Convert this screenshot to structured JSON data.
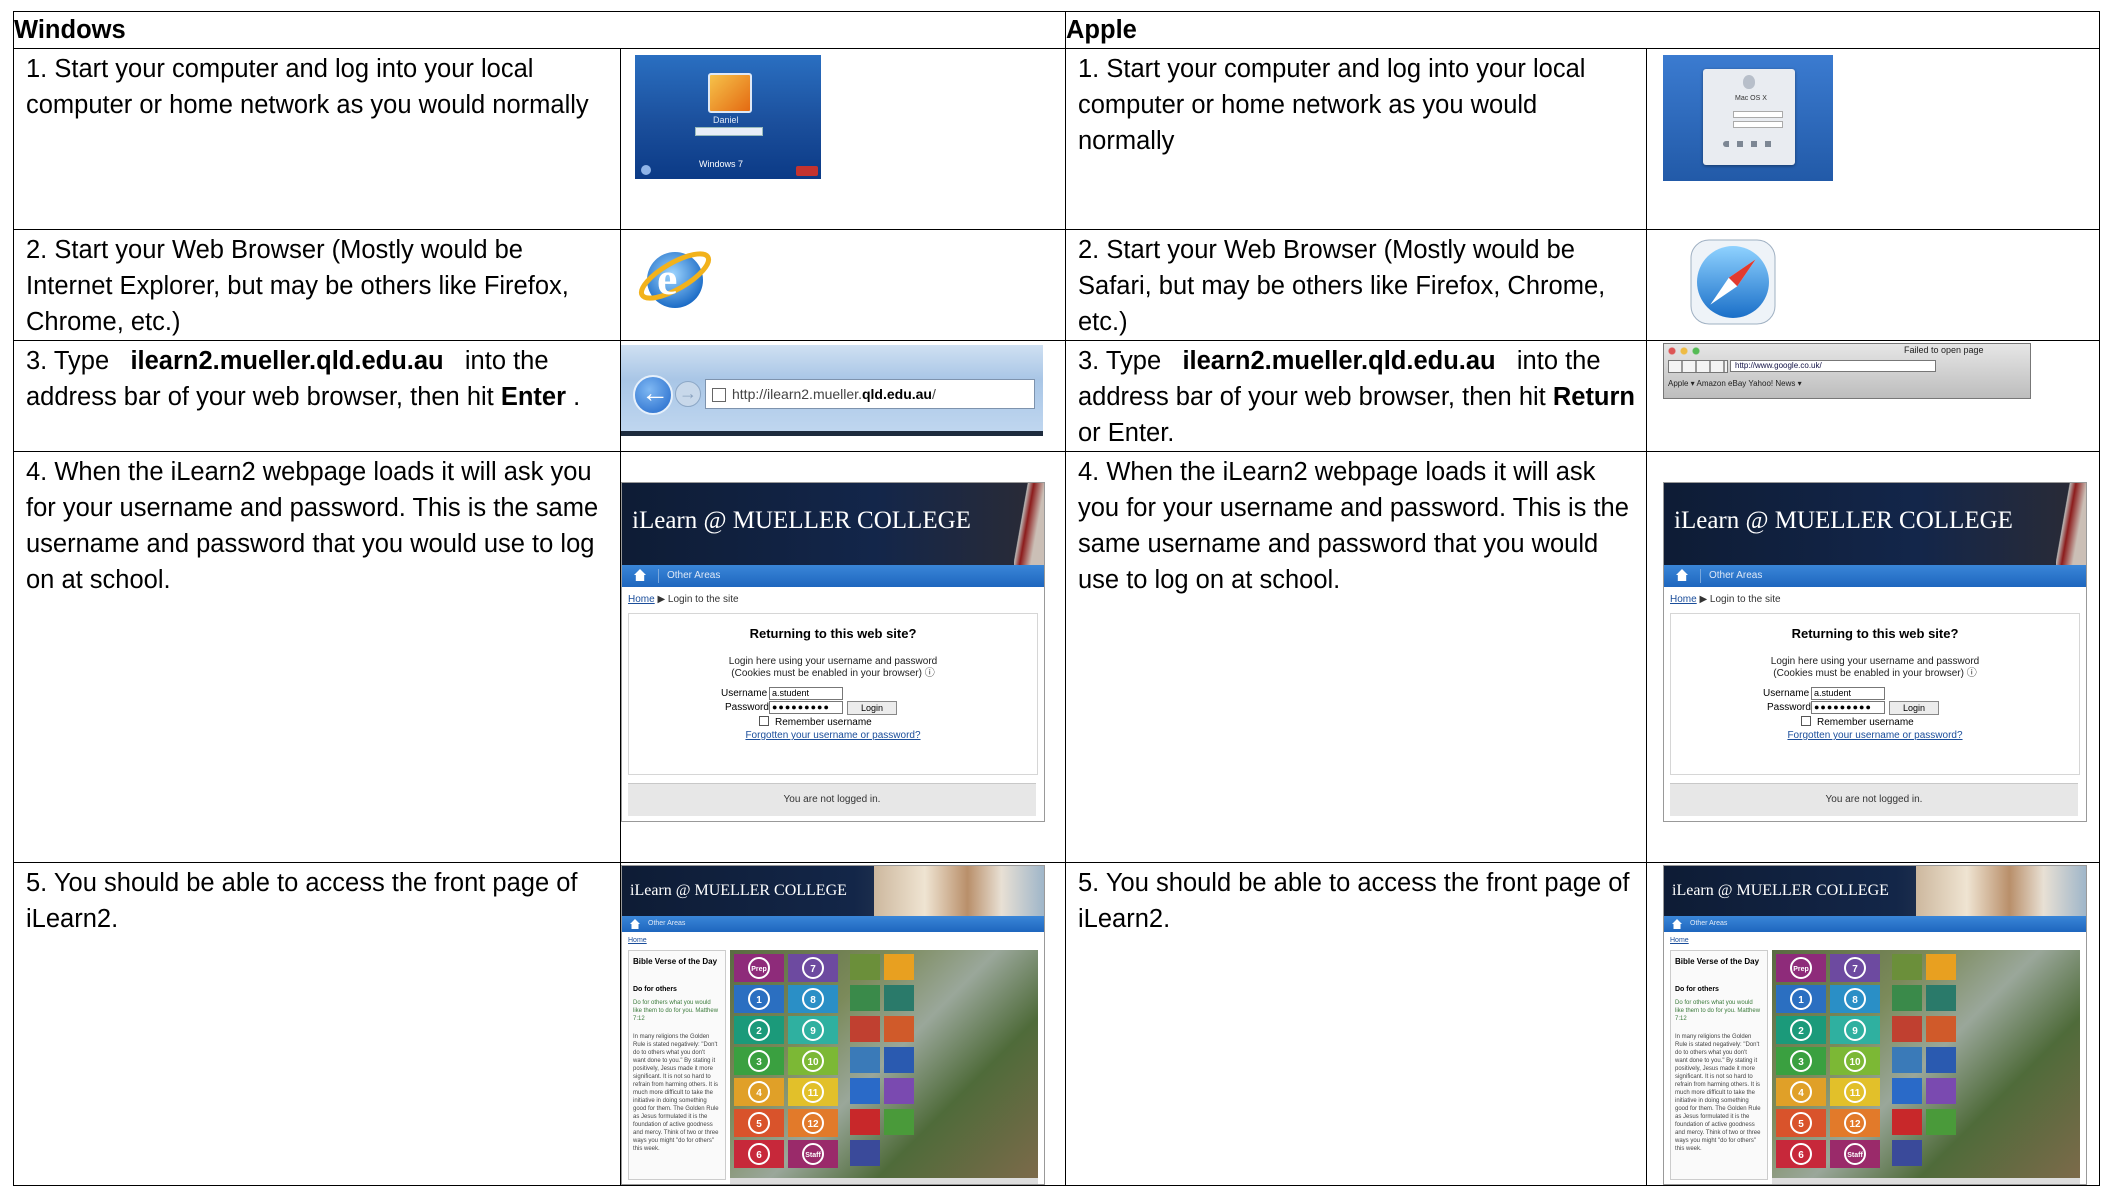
{
  "headers": {
    "windows": "Windows",
    "apple": "Apple"
  },
  "rows": [
    {
      "windows": {
        "text": "1.  Start your computer and log into your local computer or home network as you would normally"
      },
      "apple": {
        "text": "1.  Start your computer and log into your local computer or home network as you would normally"
      }
    },
    {
      "windows": {
        "text": "2.  Start your Web Browser (Mostly would be Internet Explorer, but may be others like Firefox, Chrome, etc.)"
      },
      "apple": {
        "text": "2.  Start your Web Browser (Mostly would be Safari, but may be others like Firefox, Chrome, etc.)"
      }
    },
    {
      "windows": {
        "pre": "3.  Type ",
        "url": "ilearn2.mueller.qld.edu.au",
        "mid": " into the address bar of your web browser, then hit ",
        "key": "Enter",
        "post": " ."
      },
      "apple": {
        "pre": "3.  Type ",
        "url": "ilearn2.mueller.qld.edu.au",
        "mid": " into the address bar of your web browser, then hit ",
        "key": "Return",
        "post": " or Enter."
      }
    },
    {
      "windows": {
        "text": "4.  When the iLearn2 webpage loads it will ask you for your username and password.  This is the same username and password that you would use to log on at school."
      },
      "apple": {
        "text": "4.  When the iLearn2 webpage loads it will ask you for your username and password.  This is the same username and password that you would use to log on at school."
      }
    },
    {
      "windows": {
        "text": "5.  You should be able to access the front page of iLearn2."
      },
      "apple": {
        "text": "5.  You should be able to access the front page of iLearn2."
      }
    }
  ],
  "thumbs": {
    "win_login": {
      "name": "Daniel",
      "brand": "Windows 7"
    },
    "mac_login": {
      "os": "Mac OS X"
    },
    "win_address": {
      "prefix": "http://ilearn2.mueller.",
      "bold": "qld.edu.au",
      "suffix": "/"
    },
    "mac_address": {
      "url": "http://www.google.co.uk/",
      "title": "Failed to open page",
      "bookmarks": "Apple ▾   Amazon   eBay   Yahoo!   News ▾"
    },
    "moodle_login": {
      "banner": "iLearn @ MUELLER COLLEGE",
      "nav_other": "Other Areas",
      "crumb_home": "Home",
      "crumb_rest": " ▶ Login to the site",
      "question": "Returning to this web site?",
      "line1": "Login here using your username and password",
      "line2": "(Cookies must be enabled in your browser) ⓘ",
      "username_label": "Username",
      "username_value": "a.student",
      "password_label": "Password",
      "password_value": "●●●●●●●●●",
      "login_button": "Login",
      "remember": "Remember username",
      "forgot": "Forgotten your username or password?",
      "footer": "You are not logged in."
    },
    "front": {
      "banner": "iLearn @ MUELLER COLLEGE",
      "nav_other": "Other Areas",
      "crumb": "Home",
      "side_title": "Bible Verse of the Day",
      "side_sub": "Do for others",
      "verse": "Do for others what you would like them to do for you. Matthew 7:12",
      "body": "In many religions the Golden Rule is stated negatively: \"Don't do to others what you don't want done to you.\" By stating it positively, Jesus made it more significant. It is not so hard to refrain from harming others. It is much more difficult to take the initiative in doing something good for them. The Golden Rule as Jesus formulated it is the foundation of active goodness and mercy. Think of two or three ways you might \"do for others\" this week.",
      "tiles": [
        "Prep",
        "7",
        "1",
        "8",
        "2",
        "9",
        "3",
        "10",
        "4",
        "11",
        "5",
        "12",
        "6",
        "Staff"
      ]
    }
  },
  "colors": {
    "tile_colors": [
      "#8e2b7a",
      "#6d4aa0",
      "#2b6fc1",
      "#2a8fc6",
      "#1b9a7a",
      "#2fb0a0",
      "#3aa040",
      "#7cb835",
      "#e0a028",
      "#e2c02a",
      "#d9532b",
      "#e27a2a",
      "#c7283a",
      "#9a2a6a"
    ],
    "app_colors": [
      "#6b8f3a",
      "#e8a020",
      "#3a8a4a",
      "#2a7a6a",
      "#c04030",
      "#d05a2a",
      "#3a7ab8",
      "#2a5ab0",
      "#2a6ac8",
      "#7a4ab0",
      "#c8282a",
      "#4a9a3a",
      "#3a4a9a"
    ]
  }
}
